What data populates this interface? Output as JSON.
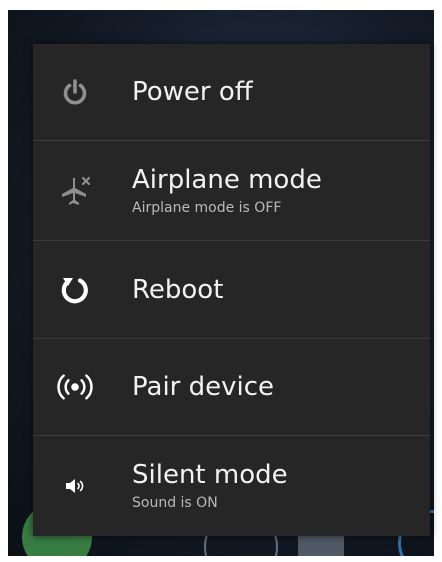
{
  "menu": {
    "items": [
      {
        "title": "Power off",
        "icon": "power-icon"
      },
      {
        "title": "Airplane mode",
        "subtitle": "Airplane mode is OFF",
        "icon": "airplane-icon"
      },
      {
        "title": "Reboot",
        "icon": "reboot-icon"
      },
      {
        "title": "Pair device",
        "icon": "broadcast-icon"
      },
      {
        "title": "Silent mode",
        "subtitle": "Sound is ON",
        "icon": "speaker-icon"
      }
    ]
  },
  "colors": {
    "dialog_bg": "#262626",
    "divider": "#3b3b3b",
    "title_text": "#f2f2f2",
    "subtitle_text": "#b9b9b9",
    "icon_muted": "#8f8f8f",
    "icon_bright": "#ffffff"
  }
}
